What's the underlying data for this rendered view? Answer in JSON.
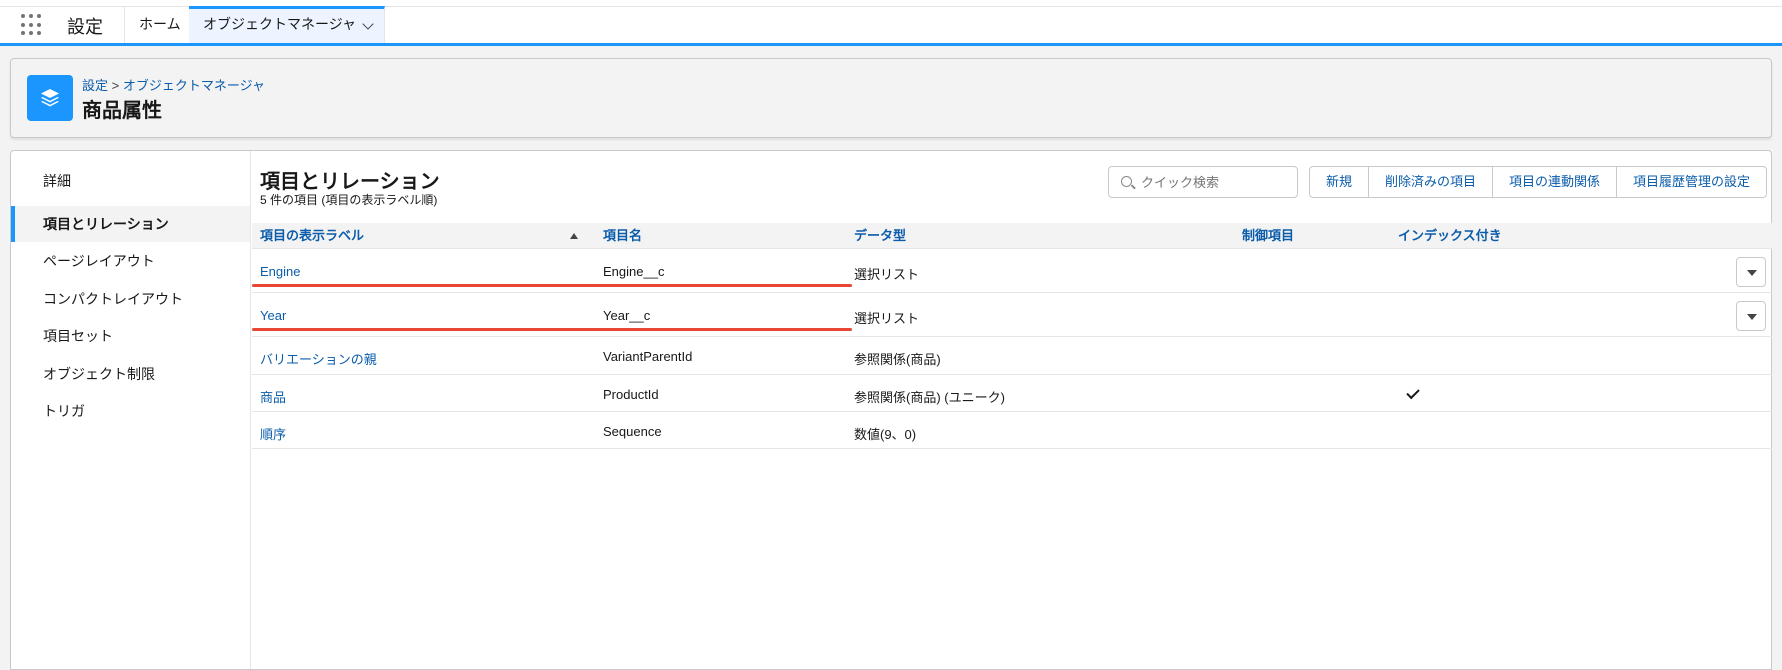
{
  "nav": {
    "app_name": "設定",
    "tabs": [
      {
        "label": "ホーム"
      },
      {
        "label": "オブジェクトマネージャ"
      }
    ]
  },
  "header": {
    "breadcrumb_root": "設定",
    "breadcrumb_sep": ">",
    "breadcrumb_current": "オブジェクトマネージャ",
    "title": "商品属性",
    "icon": "layers-icon"
  },
  "sidebar": {
    "items": [
      {
        "label": "詳細"
      },
      {
        "label": "項目とリレーション"
      },
      {
        "label": "ページレイアウト"
      },
      {
        "label": "コンパクトレイアウト"
      },
      {
        "label": "項目セット"
      },
      {
        "label": "オブジェクト制限"
      },
      {
        "label": "トリガ"
      }
    ],
    "active_index": 1
  },
  "section": {
    "title": "項目とリレーション",
    "subtitle": "5 件の項目 (項目の表示ラベル順)"
  },
  "search": {
    "placeholder": "クイック検索",
    "value": ""
  },
  "buttons": [
    "新規",
    "削除済みの項目",
    "項目の連動関係",
    "項目履歴管理の設定"
  ],
  "table": {
    "columns": [
      "項目の表示ラベル",
      "項目名",
      "データ型",
      "制御項目",
      "インデックス付き"
    ],
    "sort": "ascending",
    "rows": [
      {
        "label": "Engine",
        "name": "Engine__c",
        "type": "選択リスト",
        "controlling": "",
        "indexed": false,
        "has_menu": true,
        "underlined": true
      },
      {
        "label": "Year",
        "name": "Year__c",
        "type": "選択リスト",
        "controlling": "",
        "indexed": false,
        "has_menu": true,
        "underlined": true
      },
      {
        "label": "バリエーションの親",
        "name": "VariantParentId",
        "type": "参照関係(商品)",
        "controlling": "",
        "indexed": false,
        "has_menu": false,
        "underlined": false
      },
      {
        "label": "商品",
        "name": "ProductId",
        "type": "参照関係(商品) (ユニーク)",
        "controlling": "",
        "indexed": true,
        "has_menu": false,
        "underlined": false
      },
      {
        "label": "順序",
        "name": "Sequence",
        "type": "数値(9、0)",
        "controlling": "",
        "indexed": false,
        "has_menu": false,
        "underlined": false
      }
    ]
  },
  "colors": {
    "brand": "#1b96ff",
    "link": "#0b5cab",
    "annotation": "#e8321f"
  }
}
